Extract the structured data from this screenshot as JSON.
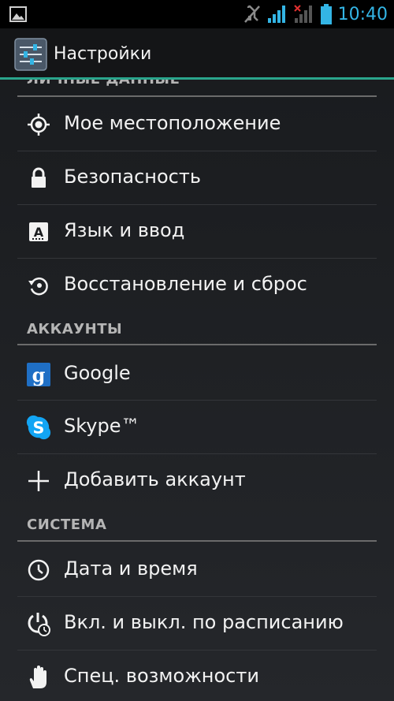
{
  "status_bar": {
    "time": "10:40",
    "icons": [
      "image-icon",
      "mute-icon",
      "signal-icon",
      "signal-no-sim-icon",
      "battery-icon"
    ]
  },
  "action_bar": {
    "title": "Настройки",
    "icon": "settings-sliders-icon",
    "accent_color": "#2aa58c"
  },
  "sections": [
    {
      "header": "ЛИЧНЫЕ ДАННЫЕ",
      "items": [
        {
          "label": "Мое местоположение",
          "icon": "location-icon"
        },
        {
          "label": "Безопасность",
          "icon": "lock-icon"
        },
        {
          "label": "Язык и ввод",
          "icon": "keyboard-letter-icon"
        },
        {
          "label": "Восстановление и сброс",
          "icon": "restore-icon"
        }
      ]
    },
    {
      "header": "АККАУНТЫ",
      "items": [
        {
          "label": "Google",
          "icon": "google-icon"
        },
        {
          "label": "Skype™",
          "icon": "skype-icon"
        },
        {
          "label": "Добавить аккаунт",
          "icon": "plus-icon"
        }
      ]
    },
    {
      "header": "СИСТЕМА",
      "items": [
        {
          "label": "Дата и время",
          "icon": "clock-icon"
        },
        {
          "label": "Вкл. и выкл. по расписанию",
          "icon": "power-schedule-icon"
        },
        {
          "label": "Спец. возможности",
          "icon": "hand-icon"
        }
      ]
    }
  ]
}
